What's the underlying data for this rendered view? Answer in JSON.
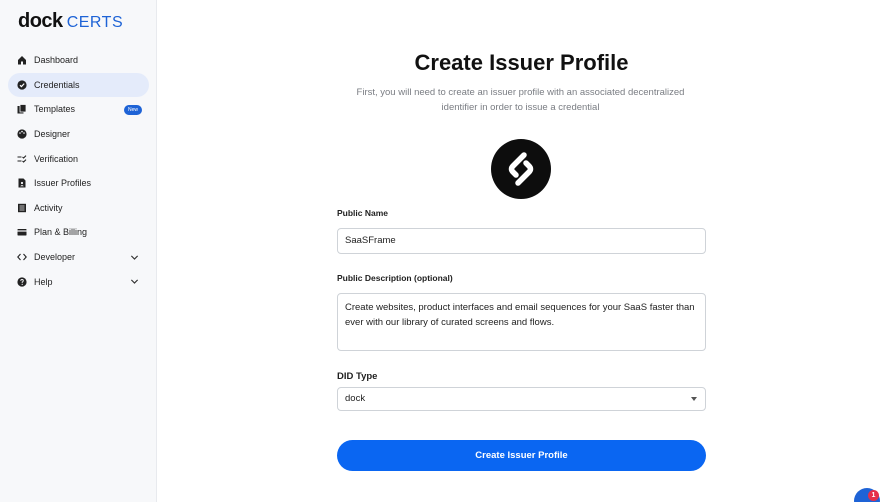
{
  "brand": {
    "part1": "dock",
    "part2": "CERTS"
  },
  "sidebar": {
    "items": [
      {
        "label": "Dashboard",
        "icon": "home-icon"
      },
      {
        "label": "Credentials",
        "icon": "verified-badge-icon",
        "active": true
      },
      {
        "label": "Templates",
        "icon": "copy-icon",
        "badge": "New"
      },
      {
        "label": "Designer",
        "icon": "palette-icon"
      },
      {
        "label": "Verification",
        "icon": "checklist-icon"
      },
      {
        "label": "Issuer Profiles",
        "icon": "document-person-icon"
      },
      {
        "label": "Activity",
        "icon": "list-icon"
      },
      {
        "label": "Plan & Billing",
        "icon": "credit-card-icon"
      },
      {
        "label": "Developer",
        "icon": "code-icon",
        "expandable": true
      },
      {
        "label": "Help",
        "icon": "help-icon",
        "expandable": true
      }
    ]
  },
  "main": {
    "title": "Create Issuer Profile",
    "subtitle": "First, you will need to create an issuer profile with an associated decentralized identifier in order to issue a credential",
    "form": {
      "public_name_label": "Public Name",
      "public_name_value": "SaaSFrame",
      "description_label": "Public Description (optional)",
      "description_value": "Create websites, product interfaces and email sequences for your SaaS faster than ever with our library of curated screens and flows.",
      "did_type_label": "DID Type",
      "did_type_value": "dock",
      "submit_label": "Create Issuer Profile"
    }
  },
  "chat": {
    "unread_count": "1"
  },
  "colors": {
    "accent": "#0a66f2",
    "brand_blue": "#1e63d6",
    "active_bg": "#e4ebfa"
  }
}
